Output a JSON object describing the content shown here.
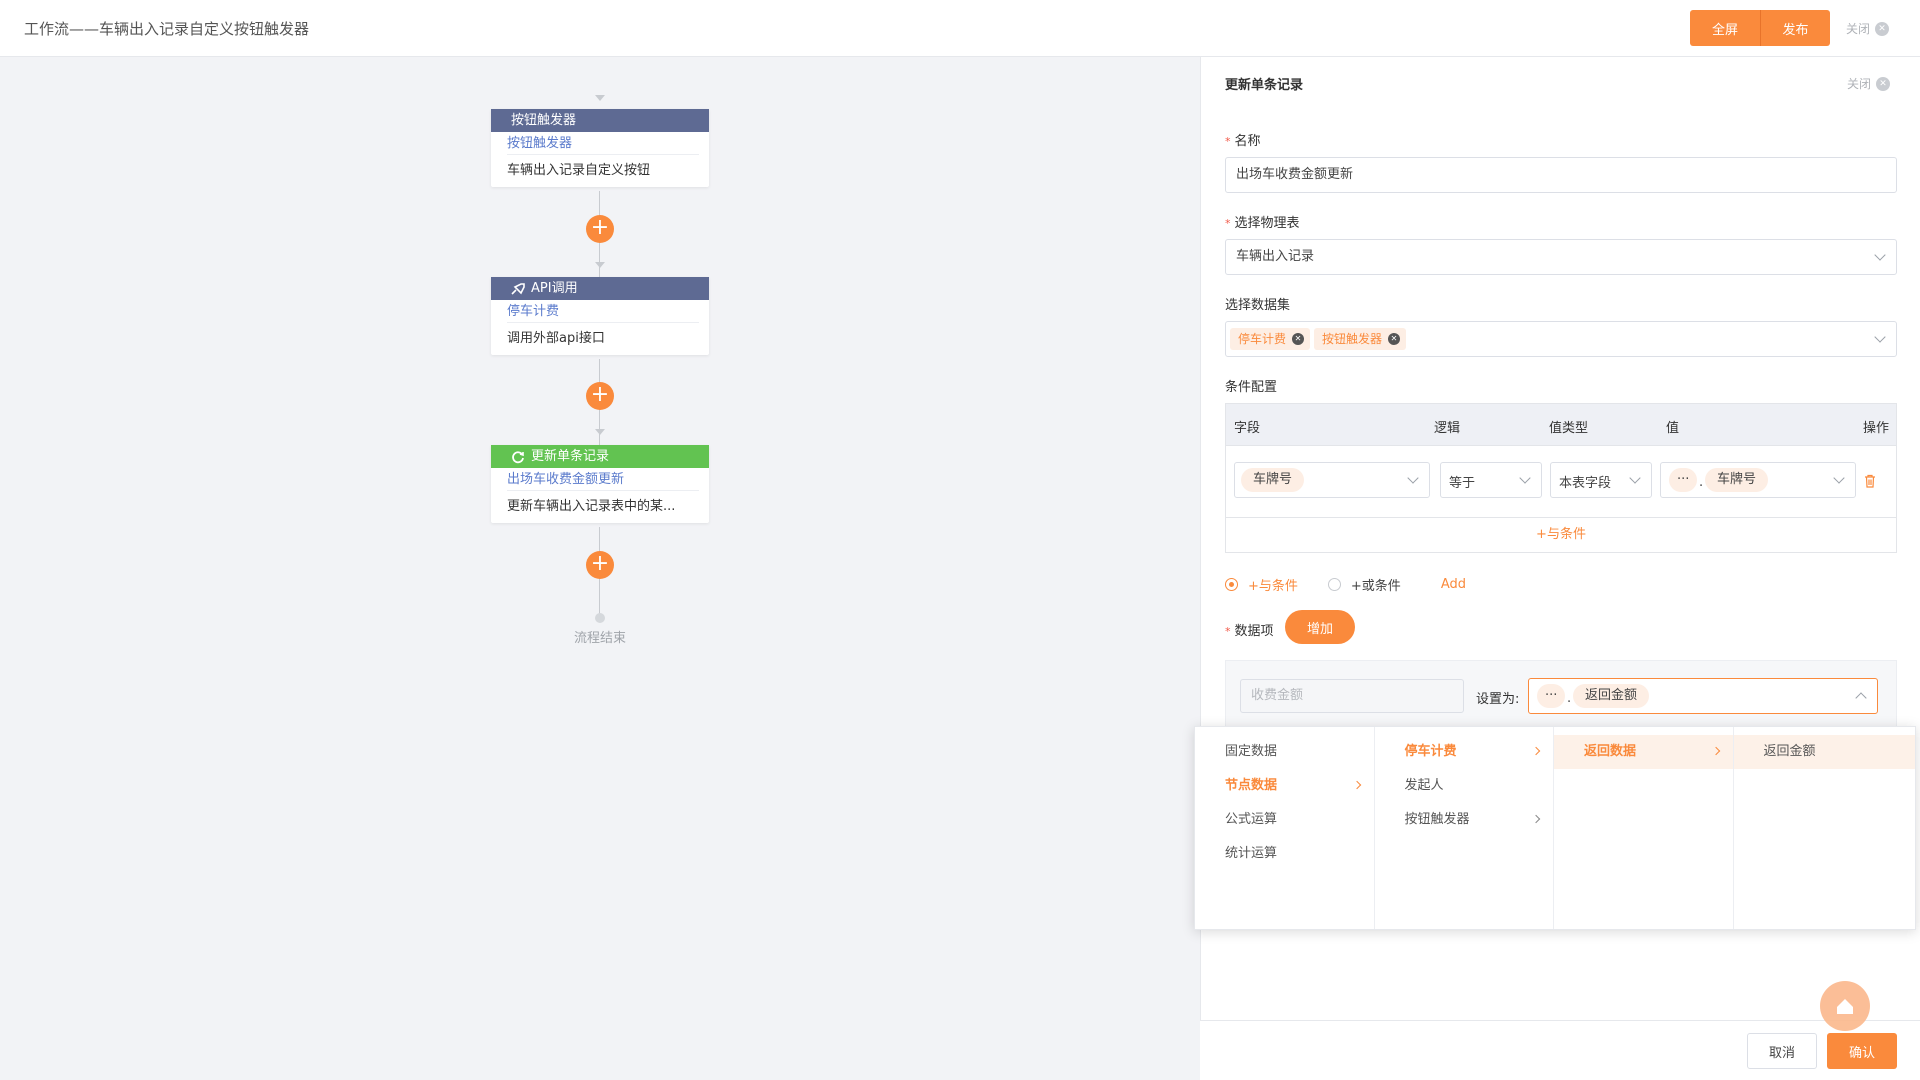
{
  "header": {
    "title": "工作流——车辆出入记录自定义按钮触发器",
    "fullscreen_label": "全屏",
    "publish_label": "发布",
    "close_label": "关闭"
  },
  "flow": {
    "nodes": [
      {
        "type": "按钮触发器",
        "name": "按钮触发器",
        "desc": "车辆出入记录自定义按钮"
      },
      {
        "type": "API调用",
        "name": "停车计费",
        "desc": "调用外部api接口"
      },
      {
        "type": "更新单条记录",
        "name": "出场车收费金额更新",
        "desc": "更新车辆出入记录表中的某..."
      }
    ],
    "end_label": "流程结束"
  },
  "panel": {
    "title": "更新单条记录",
    "close_label": "关闭",
    "name_label": "名称",
    "name_value": "出场车收费金额更新",
    "table_label": "选择物理表",
    "table_value": "车辆出入记录",
    "dataset_label": "选择数据集",
    "dataset_tags": [
      "停车计费",
      "按钮触发器"
    ],
    "cond_label": "条件配置",
    "cond_headers": {
      "field": "字段",
      "logic": "逻辑",
      "value_type": "值类型",
      "value": "值",
      "action": "操作"
    },
    "cond_row": {
      "field": "车牌号",
      "logic": "等于",
      "value_type": "本表字段",
      "value_prefix": "···",
      "value_dot": ".",
      "value": "车牌号"
    },
    "add_and": "+与条件",
    "radio_and": "+与条件",
    "radio_or": "+或条件",
    "add_link": "Add",
    "data_label": "数据项",
    "add_button": "增加",
    "data_field_placeholder": "收费金额",
    "set_as_label": "设置为:",
    "set_prefix": "···",
    "set_dot": ".",
    "set_value": "返回金额",
    "cancel_label": "取消",
    "confirm_label": "确认"
  },
  "cascade": {
    "col1": [
      "固定数据",
      "节点数据",
      "公式运算",
      "统计运算"
    ],
    "col2": [
      "停车计费",
      "发起人",
      "按钮触发器"
    ],
    "col3": [
      "返回数据"
    ],
    "col4": [
      "返回金额"
    ]
  },
  "colors": {
    "accent": "#fa8a3c",
    "node_blue": "#5e6a93",
    "node_green": "#62c351"
  }
}
